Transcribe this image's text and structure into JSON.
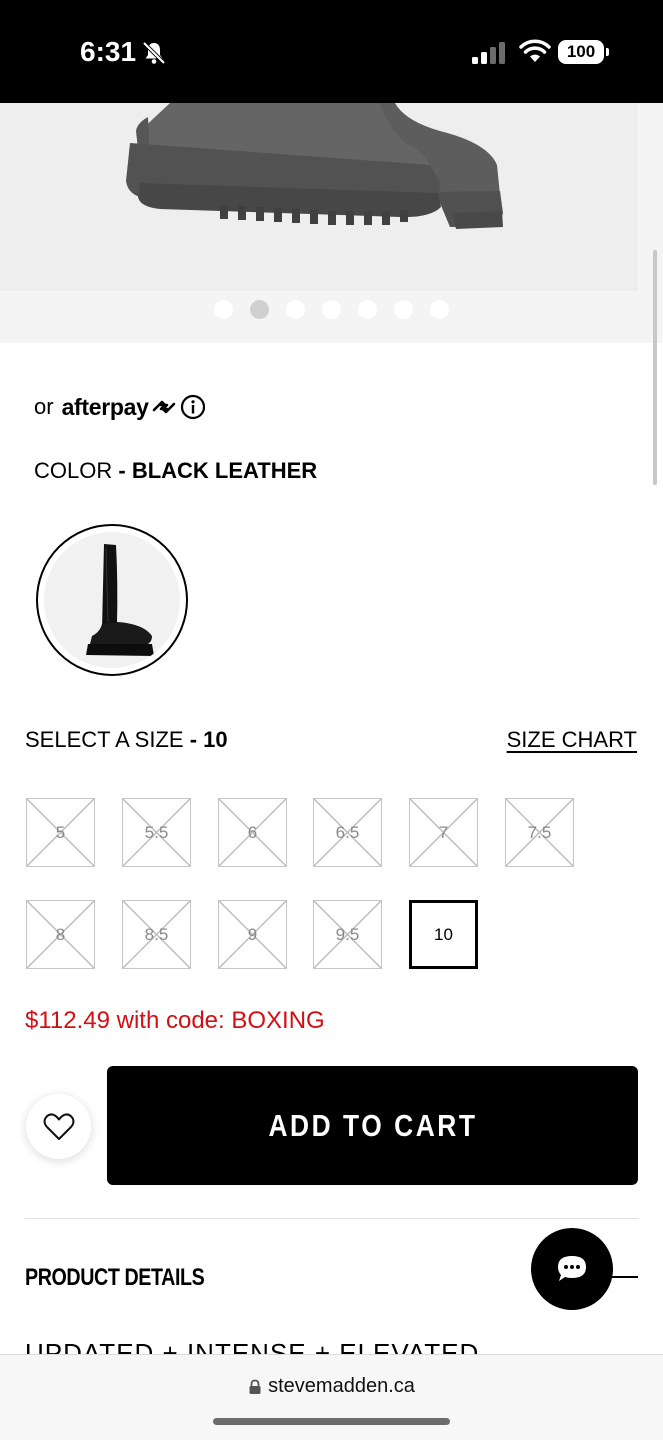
{
  "status_bar": {
    "time": "6:31",
    "battery": "100",
    "icons": [
      "bell-slash-icon",
      "cellular-signal-icon",
      "wifi-icon",
      "battery-icon"
    ]
  },
  "gallery": {
    "dot_count": 7,
    "active_index": 1
  },
  "afterpay": {
    "prefix": "or",
    "brand": "afterpay",
    "icons": [
      "afterpay-logo-icon",
      "info-icon"
    ]
  },
  "color": {
    "label": "COLOR",
    "separator": "-",
    "value": "BLACK LEATHER"
  },
  "size": {
    "label": "SELECT A SIZE",
    "separator": "-",
    "selected": "10",
    "chart_link": "SIZE CHART",
    "options": [
      {
        "label": "5",
        "available": false
      },
      {
        "label": "5.5",
        "available": false
      },
      {
        "label": "6",
        "available": false
      },
      {
        "label": "6.5",
        "available": false
      },
      {
        "label": "7",
        "available": false
      },
      {
        "label": "7.5",
        "available": false
      },
      {
        "label": "8",
        "available": false
      },
      {
        "label": "8.5",
        "available": false
      },
      {
        "label": "9",
        "available": false
      },
      {
        "label": "9.5",
        "available": false
      },
      {
        "label": "10",
        "available": true,
        "selected": true
      }
    ]
  },
  "promo": {
    "text": "$112.49 with code: BOXING",
    "color": "#d40f14"
  },
  "actions": {
    "add_to_cart": "ADD TO CART",
    "wishlist_icon": "heart-icon"
  },
  "details": {
    "title": "PRODUCT DETAILS",
    "peek": "UPDATED + INTENSE + ELEVATED"
  },
  "chat": {
    "icon": "chat-bubble-icon"
  },
  "browser": {
    "url": "stevemadden.ca"
  }
}
